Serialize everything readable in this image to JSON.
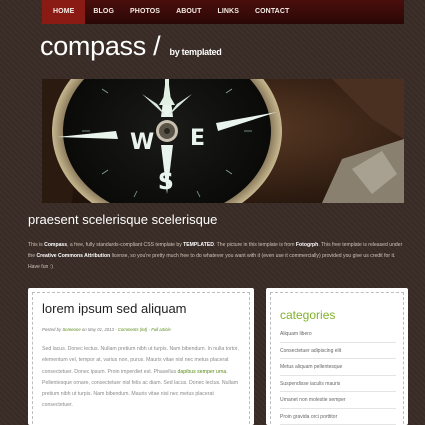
{
  "nav": {
    "items": [
      {
        "label": "HOME"
      },
      {
        "label": "BLOG"
      },
      {
        "label": "PHOTOS"
      },
      {
        "label": "ABOUT"
      },
      {
        "label": "LINKS"
      },
      {
        "label": "CONTACT"
      }
    ],
    "active": "HOME"
  },
  "logo": {
    "title": "compass /",
    "byline": "by templated"
  },
  "banner": {
    "image_description": "compass",
    "dial_letters": [
      "W",
      "E",
      "S"
    ]
  },
  "intro": {
    "title": "praesent scelerisque scelerisque",
    "t1": "This is ",
    "t2": "Compass",
    "t3": ", a free, fully standards-compliant CSS template by ",
    "t4": "TEMPLATED",
    "t5": ". The picture in this template is from ",
    "t6": "Fotogrph",
    "t7": ". This free template is released under the ",
    "t8": "Creative Commons Attribution",
    "t9": " license, so you're pretty much free to do whatever you want with it (even use it commercially) provided you give us credit for it. Have fun :)"
  },
  "post": {
    "title": "lorem ipsum sed aliquam",
    "meta_posted_by": "Posted by ",
    "meta_author": "Someone",
    "meta_on": " on May 01, 2013 - ",
    "meta_comments": "Comments (64)",
    "meta_sep": " - ",
    "meta_full": "Full article",
    "body1": "Sed lacus. Donec lectus. Nullam pretium nibh ut turpis. Nam bibendum. In nulla tortor, elementum vel, tempor at, varius non, purus. Mauris vitae nisl nec metus placerat consectetuer. Donec ipsum. Proin imperdiet est. Phasellus ",
    "body_link": "dapibus semper urna",
    "body2": ". Pellentesque ornare, consectetuer nisl felis ac diam. Sed lacus. Donec lectus. Nullam pretium nibh ut turpis. Nam bibendum. Mauris vitae nisl nec metus placerat consectetuer."
  },
  "categories": {
    "title": "categories",
    "items": [
      {
        "label": "Aliquam libero"
      },
      {
        "label": "Consectetuer adipiscing elit"
      },
      {
        "label": "Metus aliquam pellentesque"
      },
      {
        "label": "Suspendisse iaculis mauris"
      },
      {
        "label": "Urnanet non molestie semper"
      },
      {
        "label": "Proin gravida orci porttitor"
      }
    ]
  },
  "colors": {
    "nav_bg": "#3a0a08",
    "nav_active": "#8a1a14",
    "page_bg": "#3a2c26",
    "category_title": "#7fb22a",
    "link_green": "#5a8a1a"
  }
}
